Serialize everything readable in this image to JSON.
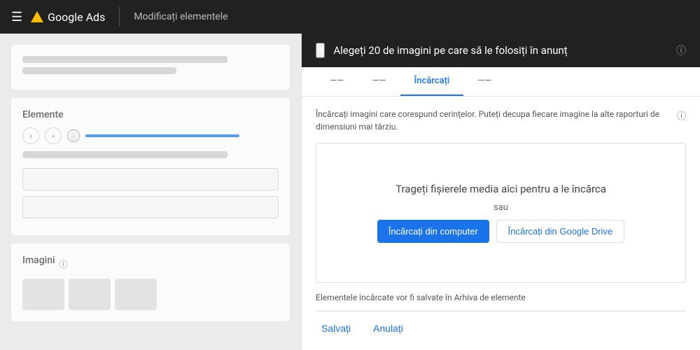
{
  "nav": {
    "menu_icon": "☰",
    "logo_alt": "Google Ads logo",
    "title": "Google Ads",
    "subtitle": "Modificați elementele"
  },
  "dialog": {
    "title": "Alegeți 20 de imagini pe care să le folosiți în anunț",
    "close_label": "×",
    "help_icon": "ⓘ",
    "tabs": [
      {
        "label": "——",
        "id": "tab1"
      },
      {
        "label": "——",
        "id": "tab2"
      },
      {
        "label": "Încărcați",
        "id": "tab3",
        "active": true
      },
      {
        "label": "——",
        "id": "tab4"
      }
    ],
    "description": "Încărcați imagini care corespund cerințelor. Puteți decupa fiecare imagine la alte raporturi de dimensiuni mai târziu.",
    "desc_info_icon": "ⓘ",
    "drop_zone": {
      "text": "Trageți fișierele media aici pentru a le încărca",
      "or_label": "sau",
      "btn_computer": "Încărcați din computer",
      "btn_drive": "Încărcați din Google Drive"
    },
    "footer_info": "Elementele încărcate vor fi salvate în Arhiva de elemente",
    "save_label": "Salvați",
    "cancel_label": "Anulați"
  },
  "left_panel": {
    "elements_label": "Elemente",
    "images_label": "Imagini",
    "info_icon": "ⓘ",
    "left_arrow": "‹",
    "right_arrow": "›"
  }
}
